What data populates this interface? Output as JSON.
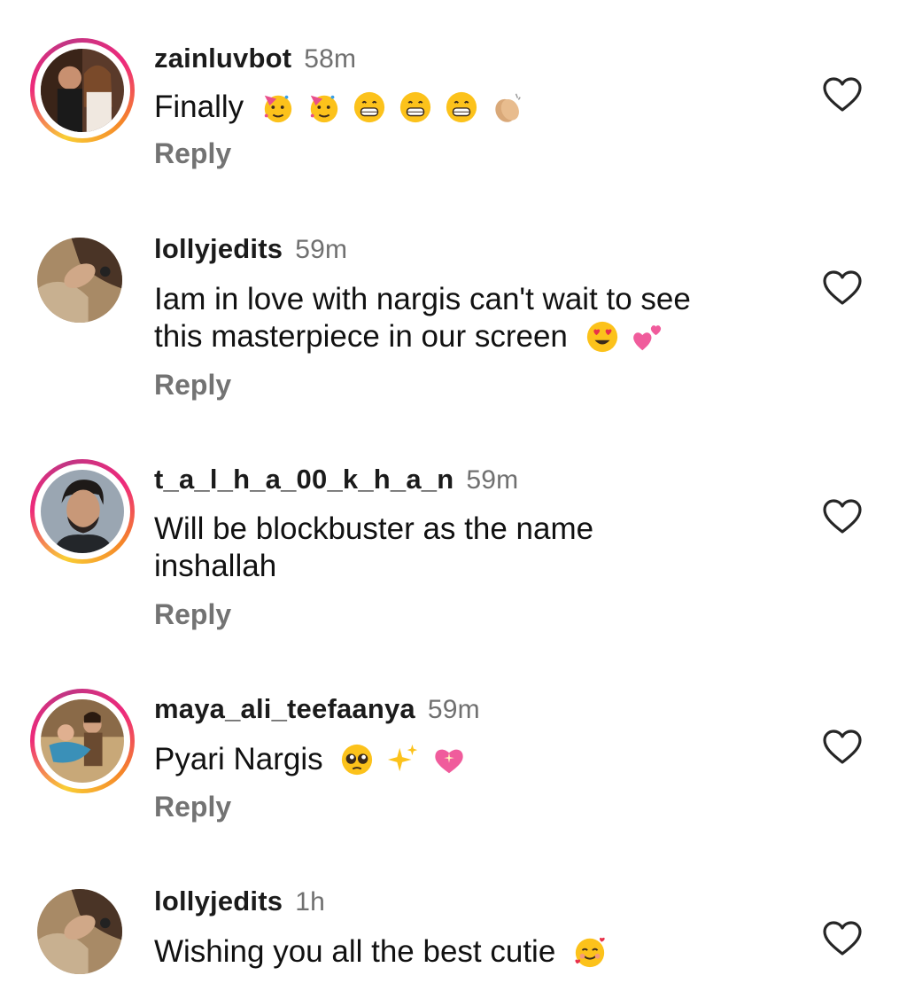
{
  "comments": [
    {
      "username": "zainluvbot",
      "time": "58m",
      "text": "Finally",
      "emojis": [
        "partying-face-emoji",
        "partying-face-emoji",
        "grinning-face-emoji",
        "grinning-face-emoji",
        "grinning-face-emoji",
        "clapping-hands-emoji"
      ],
      "reply": "Reply",
      "avatar_story_ring": true
    },
    {
      "username": "lollyjedits",
      "time": "59m",
      "text_line1": "Iam in love with nargis can't wait to see",
      "text_line2": "this masterpiece in our screen",
      "emojis": [
        "heart-eyes-emoji",
        "two-hearts-emoji"
      ],
      "reply": "Reply",
      "avatar_story_ring": false
    },
    {
      "username": "t_a_l_h_a_00_k_h_a_n",
      "time": "59m",
      "text_line1": "Will be blockbuster as the name",
      "text_line2": "inshallah",
      "reply": "Reply",
      "avatar_story_ring": true
    },
    {
      "username": "maya_ali_teefaanya",
      "time": "59m",
      "text": "Pyari Nargis",
      "emojis": [
        "pleading-face-emoji",
        "sparkles-emoji",
        "sparkling-heart-emoji"
      ],
      "reply": "Reply",
      "avatar_story_ring": true
    },
    {
      "username": "lollyjedits",
      "time": "1h",
      "text": "Wishing you all the best cutie",
      "emojis": [
        "smiling-face-with-hearts-emoji"
      ],
      "avatar_story_ring": false
    }
  ],
  "colors": {
    "username": "#1b1b1b",
    "time": "#707070",
    "reply": "#737373",
    "ring_start": "#f9ce34",
    "ring_mid": "#ee2a7b",
    "ring_end": "#c13584"
  }
}
